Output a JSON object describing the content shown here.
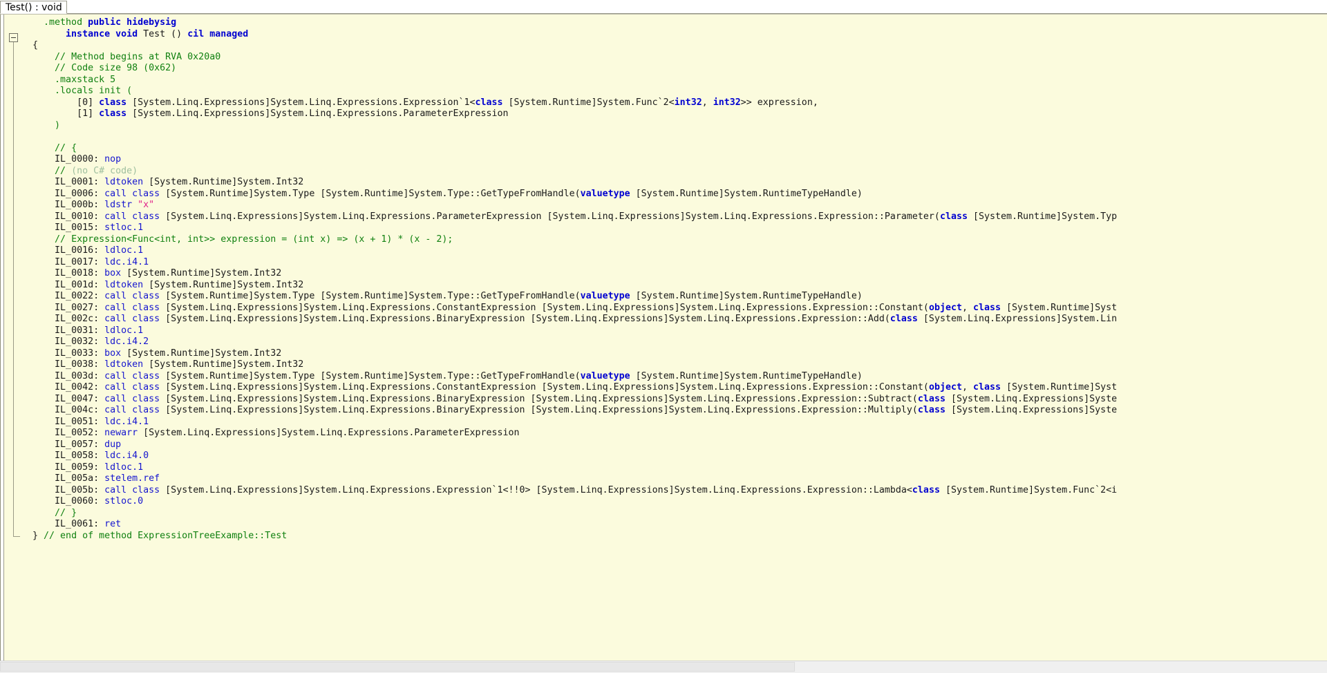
{
  "window": {
    "background": "#fbfbdd",
    "accent": "#0000d0"
  },
  "tabs": [
    {
      "label": "Test() : void",
      "active": true
    }
  ],
  "gutter": {
    "fold_marker": "minus-collapse-box"
  },
  "code": {
    "language": "IL",
    "lines": [
      {
        "indent": 4,
        "segments": [
          {
            "t": ".method",
            "c": "com"
          },
          {
            "t": " ",
            "c": "plain"
          },
          {
            "t": "public hidebysig",
            "c": "kw"
          }
        ]
      },
      {
        "indent": 8,
        "segments": [
          {
            "t": "instance void",
            "c": "kw"
          },
          {
            "t": " Test () ",
            "c": "plain"
          },
          {
            "t": "cil managed",
            "c": "kw"
          }
        ]
      },
      {
        "indent": 2,
        "segments": [
          {
            "t": "{",
            "c": "brace"
          }
        ]
      },
      {
        "indent": 6,
        "segments": [
          {
            "t": "// Method begins at RVA 0x20a0",
            "c": "com"
          }
        ]
      },
      {
        "indent": 6,
        "segments": [
          {
            "t": "// Code size 98 (0x62)",
            "c": "com"
          }
        ]
      },
      {
        "indent": 6,
        "segments": [
          {
            "t": ".maxstack 5",
            "c": "com"
          }
        ]
      },
      {
        "indent": 6,
        "segments": [
          {
            "t": ".locals init (",
            "c": "com"
          }
        ]
      },
      {
        "indent": 10,
        "segments": [
          {
            "t": "[0] ",
            "c": "plain"
          },
          {
            "t": "class",
            "c": "kw"
          },
          {
            "t": " [System.Linq.Expressions]System.Linq.Expressions.Expression`1<",
            "c": "plain"
          },
          {
            "t": "class",
            "c": "kw"
          },
          {
            "t": " [System.Runtime]System.Func`2<",
            "c": "plain"
          },
          {
            "t": "int32",
            "c": "kw"
          },
          {
            "t": ", ",
            "c": "plain"
          },
          {
            "t": "int32",
            "c": "kw"
          },
          {
            "t": ">> expression,",
            "c": "plain"
          }
        ]
      },
      {
        "indent": 10,
        "segments": [
          {
            "t": "[1] ",
            "c": "plain"
          },
          {
            "t": "class",
            "c": "kw"
          },
          {
            "t": " [System.Linq.Expressions]System.Linq.Expressions.ParameterExpression",
            "c": "plain"
          }
        ]
      },
      {
        "indent": 6,
        "segments": [
          {
            "t": ")",
            "c": "com"
          }
        ]
      },
      {
        "indent": 0,
        "segments": []
      },
      {
        "indent": 6,
        "segments": [
          {
            "t": "// {",
            "c": "com"
          }
        ]
      },
      {
        "indent": 6,
        "segments": [
          {
            "t": "IL_0000: ",
            "c": "plain"
          },
          {
            "t": "nop",
            "c": "opcode"
          }
        ]
      },
      {
        "indent": 6,
        "segments": [
          {
            "t": "// ",
            "c": "com"
          },
          {
            "t": "(no C# code)",
            "c": "com-d"
          }
        ]
      },
      {
        "indent": 6,
        "segments": [
          {
            "t": "IL_0001: ",
            "c": "plain"
          },
          {
            "t": "ldtoken",
            "c": "opcode"
          },
          {
            "t": " [System.Runtime]System.Int32",
            "c": "plain"
          }
        ]
      },
      {
        "indent": 6,
        "segments": [
          {
            "t": "IL_0006: ",
            "c": "plain"
          },
          {
            "t": "call class",
            "c": "opcode"
          },
          {
            "t": " [System.Runtime]System.Type [System.Runtime]System.Type::GetTypeFromHandle(",
            "c": "plain"
          },
          {
            "t": "valuetype",
            "c": "kw"
          },
          {
            "t": " [System.Runtime]System.RuntimeTypeHandle)",
            "c": "plain"
          }
        ]
      },
      {
        "indent": 6,
        "segments": [
          {
            "t": "IL_000b: ",
            "c": "plain"
          },
          {
            "t": "ldstr",
            "c": "opcode"
          },
          {
            "t": " ",
            "c": "plain"
          },
          {
            "t": "\"x\"",
            "c": "str"
          }
        ]
      },
      {
        "indent": 6,
        "segments": [
          {
            "t": "IL_0010: ",
            "c": "plain"
          },
          {
            "t": "call class",
            "c": "opcode"
          },
          {
            "t": " [System.Linq.Expressions]System.Linq.Expressions.ParameterExpression [System.Linq.Expressions]System.Linq.Expressions.Expression::Parameter(",
            "c": "plain"
          },
          {
            "t": "class",
            "c": "kw"
          },
          {
            "t": " [System.Runtime]System.Typ",
            "c": "plain"
          }
        ]
      },
      {
        "indent": 6,
        "segments": [
          {
            "t": "IL_0015: ",
            "c": "plain"
          },
          {
            "t": "stloc.1",
            "c": "opcode"
          }
        ]
      },
      {
        "indent": 6,
        "segments": [
          {
            "t": "// Expression<Func<int, int>> expression = (int x) => (x + 1) * (x - 2);",
            "c": "com"
          }
        ]
      },
      {
        "indent": 6,
        "segments": [
          {
            "t": "IL_0016: ",
            "c": "plain"
          },
          {
            "t": "ldloc.1",
            "c": "opcode"
          }
        ]
      },
      {
        "indent": 6,
        "segments": [
          {
            "t": "IL_0017: ",
            "c": "plain"
          },
          {
            "t": "ldc.i4.1",
            "c": "opcode"
          }
        ]
      },
      {
        "indent": 6,
        "segments": [
          {
            "t": "IL_0018: ",
            "c": "plain"
          },
          {
            "t": "box",
            "c": "opcode"
          },
          {
            "t": " [System.Runtime]System.Int32",
            "c": "plain"
          }
        ]
      },
      {
        "indent": 6,
        "segments": [
          {
            "t": "IL_001d: ",
            "c": "plain"
          },
          {
            "t": "ldtoken",
            "c": "opcode"
          },
          {
            "t": " [System.Runtime]System.Int32",
            "c": "plain"
          }
        ]
      },
      {
        "indent": 6,
        "segments": [
          {
            "t": "IL_0022: ",
            "c": "plain"
          },
          {
            "t": "call class",
            "c": "opcode"
          },
          {
            "t": " [System.Runtime]System.Type [System.Runtime]System.Type::GetTypeFromHandle(",
            "c": "plain"
          },
          {
            "t": "valuetype",
            "c": "kw"
          },
          {
            "t": " [System.Runtime]System.RuntimeTypeHandle)",
            "c": "plain"
          }
        ]
      },
      {
        "indent": 6,
        "segments": [
          {
            "t": "IL_0027: ",
            "c": "plain"
          },
          {
            "t": "call class",
            "c": "opcode"
          },
          {
            "t": " [System.Linq.Expressions]System.Linq.Expressions.ConstantExpression [System.Linq.Expressions]System.Linq.Expressions.Expression::Constant(",
            "c": "plain"
          },
          {
            "t": "object",
            "c": "kw"
          },
          {
            "t": ", ",
            "c": "plain"
          },
          {
            "t": "class",
            "c": "kw"
          },
          {
            "t": " [System.Runtime]Syst",
            "c": "plain"
          }
        ]
      },
      {
        "indent": 6,
        "segments": [
          {
            "t": "IL_002c: ",
            "c": "plain"
          },
          {
            "t": "call class",
            "c": "opcode"
          },
          {
            "t": " [System.Linq.Expressions]System.Linq.Expressions.BinaryExpression [System.Linq.Expressions]System.Linq.Expressions.Expression::Add(",
            "c": "plain"
          },
          {
            "t": "class",
            "c": "kw"
          },
          {
            "t": " [System.Linq.Expressions]System.Lin",
            "c": "plain"
          }
        ]
      },
      {
        "indent": 6,
        "segments": [
          {
            "t": "IL_0031: ",
            "c": "plain"
          },
          {
            "t": "ldloc.1",
            "c": "opcode"
          }
        ]
      },
      {
        "indent": 6,
        "segments": [
          {
            "t": "IL_0032: ",
            "c": "plain"
          },
          {
            "t": "ldc.i4.2",
            "c": "opcode"
          }
        ]
      },
      {
        "indent": 6,
        "segments": [
          {
            "t": "IL_0033: ",
            "c": "plain"
          },
          {
            "t": "box",
            "c": "opcode"
          },
          {
            "t": " [System.Runtime]System.Int32",
            "c": "plain"
          }
        ]
      },
      {
        "indent": 6,
        "segments": [
          {
            "t": "IL_0038: ",
            "c": "plain"
          },
          {
            "t": "ldtoken",
            "c": "opcode"
          },
          {
            "t": " [System.Runtime]System.Int32",
            "c": "plain"
          }
        ]
      },
      {
        "indent": 6,
        "segments": [
          {
            "t": "IL_003d: ",
            "c": "plain"
          },
          {
            "t": "call class",
            "c": "opcode"
          },
          {
            "t": " [System.Runtime]System.Type [System.Runtime]System.Type::GetTypeFromHandle(",
            "c": "plain"
          },
          {
            "t": "valuetype",
            "c": "kw"
          },
          {
            "t": " [System.Runtime]System.RuntimeTypeHandle)",
            "c": "plain"
          }
        ]
      },
      {
        "indent": 6,
        "segments": [
          {
            "t": "IL_0042: ",
            "c": "plain"
          },
          {
            "t": "call class",
            "c": "opcode"
          },
          {
            "t": " [System.Linq.Expressions]System.Linq.Expressions.ConstantExpression [System.Linq.Expressions]System.Linq.Expressions.Expression::Constant(",
            "c": "plain"
          },
          {
            "t": "object",
            "c": "kw"
          },
          {
            "t": ", ",
            "c": "plain"
          },
          {
            "t": "class",
            "c": "kw"
          },
          {
            "t": " [System.Runtime]Syst",
            "c": "plain"
          }
        ]
      },
      {
        "indent": 6,
        "segments": [
          {
            "t": "IL_0047: ",
            "c": "plain"
          },
          {
            "t": "call class",
            "c": "opcode"
          },
          {
            "t": " [System.Linq.Expressions]System.Linq.Expressions.BinaryExpression [System.Linq.Expressions]System.Linq.Expressions.Expression::Subtract(",
            "c": "plain"
          },
          {
            "t": "class",
            "c": "kw"
          },
          {
            "t": " [System.Linq.Expressions]Syste",
            "c": "plain"
          }
        ]
      },
      {
        "indent": 6,
        "segments": [
          {
            "t": "IL_004c: ",
            "c": "plain"
          },
          {
            "t": "call class",
            "c": "opcode"
          },
          {
            "t": " [System.Linq.Expressions]System.Linq.Expressions.BinaryExpression [System.Linq.Expressions]System.Linq.Expressions.Expression::Multiply(",
            "c": "plain"
          },
          {
            "t": "class",
            "c": "kw"
          },
          {
            "t": " [System.Linq.Expressions]Syste",
            "c": "plain"
          }
        ]
      },
      {
        "indent": 6,
        "segments": [
          {
            "t": "IL_0051: ",
            "c": "plain"
          },
          {
            "t": "ldc.i4.1",
            "c": "opcode"
          }
        ]
      },
      {
        "indent": 6,
        "segments": [
          {
            "t": "IL_0052: ",
            "c": "plain"
          },
          {
            "t": "newarr",
            "c": "opcode"
          },
          {
            "t": " [System.Linq.Expressions]System.Linq.Expressions.ParameterExpression",
            "c": "plain"
          }
        ]
      },
      {
        "indent": 6,
        "segments": [
          {
            "t": "IL_0057: ",
            "c": "plain"
          },
          {
            "t": "dup",
            "c": "opcode"
          }
        ]
      },
      {
        "indent": 6,
        "segments": [
          {
            "t": "IL_0058: ",
            "c": "plain"
          },
          {
            "t": "ldc.i4.0",
            "c": "opcode"
          }
        ]
      },
      {
        "indent": 6,
        "segments": [
          {
            "t": "IL_0059: ",
            "c": "plain"
          },
          {
            "t": "ldloc.1",
            "c": "opcode"
          }
        ]
      },
      {
        "indent": 6,
        "segments": [
          {
            "t": "IL_005a: ",
            "c": "plain"
          },
          {
            "t": "stelem.ref",
            "c": "opcode"
          }
        ]
      },
      {
        "indent": 6,
        "segments": [
          {
            "t": "IL_005b: ",
            "c": "plain"
          },
          {
            "t": "call class",
            "c": "opcode"
          },
          {
            "t": " [System.Linq.Expressions]System.Linq.Expressions.Expression`1<!!0> [System.Linq.Expressions]System.Linq.Expressions.Expression::Lambda<",
            "c": "plain"
          },
          {
            "t": "class",
            "c": "kw"
          },
          {
            "t": " [System.Runtime]System.Func`2<i",
            "c": "plain"
          }
        ]
      },
      {
        "indent": 6,
        "segments": [
          {
            "t": "IL_0060: ",
            "c": "plain"
          },
          {
            "t": "stloc.0",
            "c": "opcode"
          }
        ]
      },
      {
        "indent": 6,
        "segments": [
          {
            "t": "// }",
            "c": "com"
          }
        ]
      },
      {
        "indent": 6,
        "segments": [
          {
            "t": "IL_0061: ",
            "c": "plain"
          },
          {
            "t": "ret",
            "c": "opcode"
          }
        ]
      },
      {
        "indent": 2,
        "segments": [
          {
            "t": "}",
            "c": "brace"
          },
          {
            "t": " // end of method ExpressionTreeExample::Test",
            "c": "com"
          }
        ]
      }
    ]
  },
  "scrollbar": {
    "horizontal_visible": true
  }
}
